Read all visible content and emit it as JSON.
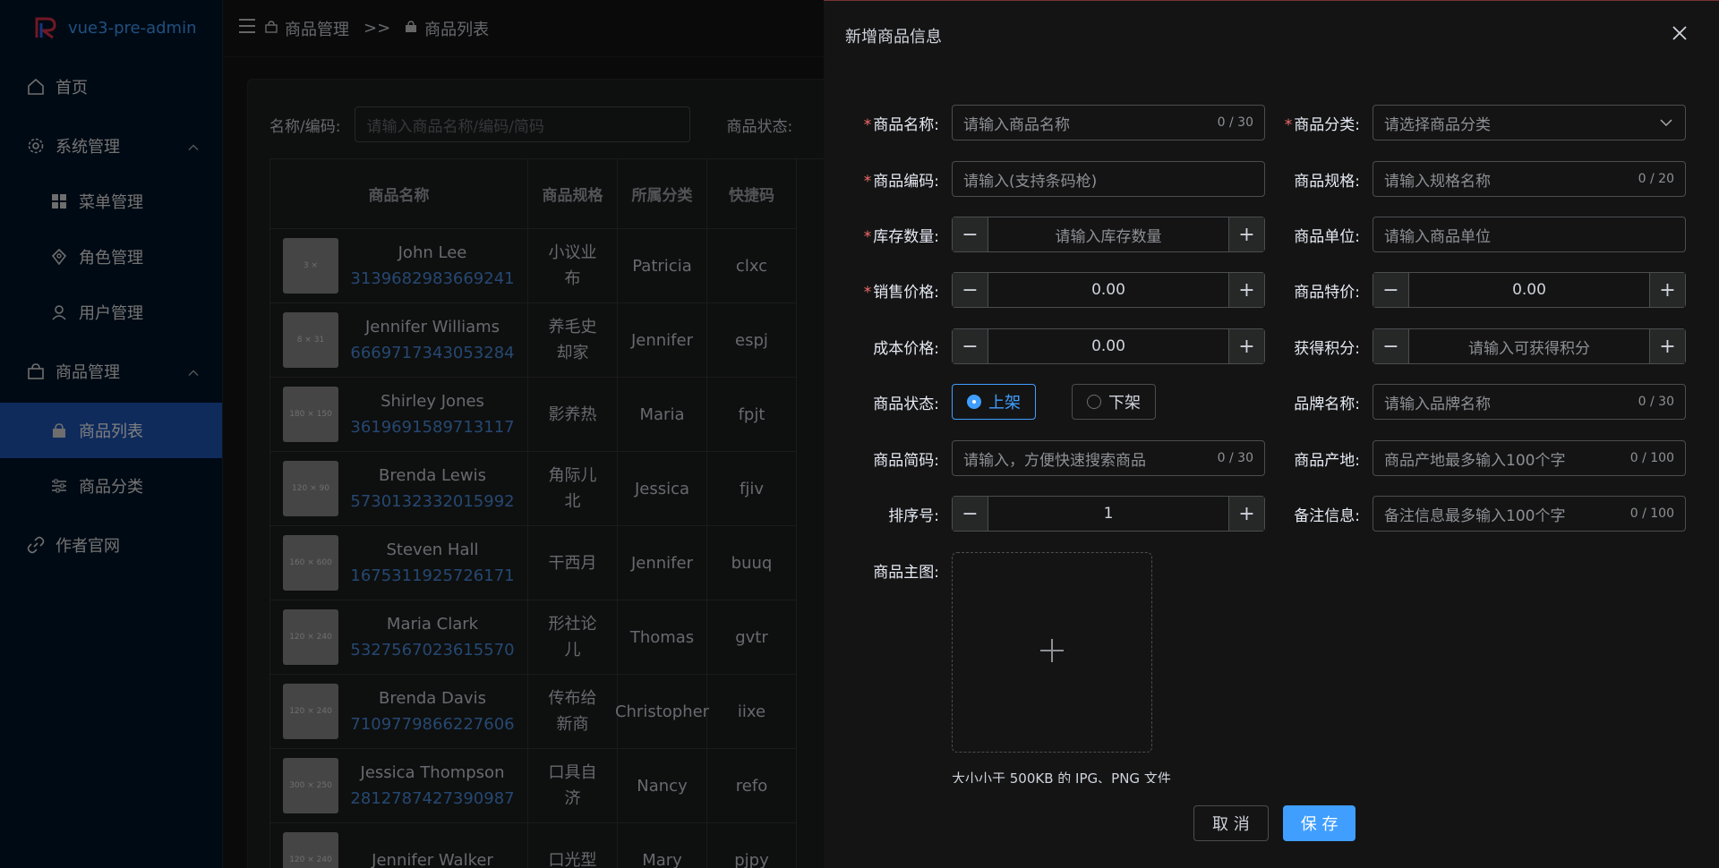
{
  "app": {
    "title": "vue3-pre-admin"
  },
  "sidebar": {
    "items": [
      {
        "label": "首页"
      },
      {
        "label": "系统管理"
      },
      {
        "label": "菜单管理"
      },
      {
        "label": "角色管理"
      },
      {
        "label": "用户管理"
      },
      {
        "label": "商品管理"
      },
      {
        "label": "商品列表"
      },
      {
        "label": "商品分类"
      },
      {
        "label": "作者官网"
      }
    ]
  },
  "breadcrumb": {
    "first": "商品管理",
    "sep": ">>",
    "second": "商品列表"
  },
  "filter": {
    "name_label": "名称/编码:",
    "name_placeholder": "请输入商品名称/编码/简码",
    "status_label": "商品状态:"
  },
  "table": {
    "headers": [
      "商品名称",
      "商品规格",
      "所属分类",
      "快捷码"
    ],
    "rows": [
      {
        "thumb": "3 ×",
        "name": "John Lee",
        "code": "3139682983669241",
        "spec": "小议业布",
        "cat": "Patricia",
        "quick": "clxc"
      },
      {
        "thumb": "8 × 31",
        "name": "Jennifer Williams",
        "code": "6669717343053284",
        "spec": "养毛史却家",
        "cat": "Jennifer",
        "quick": "espj"
      },
      {
        "thumb": "180 × 150",
        "name": "Shirley Jones",
        "code": "3619691589713117",
        "spec": "影养热",
        "cat": "Maria",
        "quick": "fpjt"
      },
      {
        "thumb": "120 × 90",
        "name": "Brenda Lewis",
        "code": "5730132332015992",
        "spec": "角际儿北",
        "cat": "Jessica",
        "quick": "fjiv"
      },
      {
        "thumb": "160 × 600",
        "name": "Steven Hall",
        "code": "1675311925726171",
        "spec": "干西月",
        "cat": "Jennifer",
        "quick": "buuq"
      },
      {
        "thumb": "120 × 240",
        "name": "Maria Clark",
        "code": "5327567023615570",
        "spec": "形社论儿",
        "cat": "Thomas",
        "quick": "gvtr"
      },
      {
        "thumb": "120 × 240",
        "name": "Brenda Davis",
        "code": "7109779866227606",
        "spec": "传布给新商",
        "cat": "Christopher",
        "quick": "iixe"
      },
      {
        "thumb": "300 × 250",
        "name": "Jessica Thompson",
        "code": "2812787427390987",
        "spec": "口具自济",
        "cat": "Nancy",
        "quick": "refo"
      },
      {
        "thumb": "120 × 240",
        "name": "Jennifer Walker",
        "code": "",
        "spec": "口光型",
        "cat": "Mary",
        "quick": "pjpy"
      }
    ]
  },
  "drawer": {
    "title": "新增商品信息",
    "fields": {
      "name": {
        "label": "商品名称:",
        "placeholder": "请输入商品名称",
        "count": "0 / 30"
      },
      "category": {
        "label": "商品分类:",
        "placeholder": "请选择商品分类"
      },
      "code": {
        "label": "商品编码:",
        "placeholder": "请输入(支持条码枪)"
      },
      "spec": {
        "label": "商品规格:",
        "placeholder": "请输入规格名称",
        "count": "0 / 20"
      },
      "stock": {
        "label": "库存数量:",
        "placeholder": "请输入库存数量"
      },
      "unit": {
        "label": "商品单位:",
        "placeholder": "请输入商品单位"
      },
      "price": {
        "label": "销售价格:",
        "value": "0.00"
      },
      "special": {
        "label": "商品特价:",
        "value": "0.00"
      },
      "cost": {
        "label": "成本价格:",
        "value": "0.00"
      },
      "points": {
        "label": "获得积分:",
        "placeholder": "请输入可获得积分"
      },
      "status": {
        "label": "商品状态:",
        "on": "上架",
        "off": "下架"
      },
      "brand": {
        "label": "品牌名称:",
        "placeholder": "请输入品牌名称",
        "count": "0 / 30"
      },
      "short": {
        "label": "商品简码:",
        "placeholder": "请输入，方便快速搜索商品",
        "count": "0 / 30"
      },
      "origin": {
        "label": "商品产地:",
        "placeholder": "商品产地最多输入100个字",
        "count": "0 / 100"
      },
      "sort": {
        "label": "排序号:",
        "value": "1"
      },
      "remark": {
        "label": "备注信息:",
        "placeholder": "备注信息最多输入100个字",
        "count": "0 / 100"
      },
      "image": {
        "label": "商品主图:",
        "tip": "大小小于 500KB 的 JPG、PNG 文件"
      }
    },
    "cancel": "取 消",
    "save": "保 存"
  },
  "colors": {
    "accent": "#409eff",
    "sidebar_bg": "#001529",
    "active_bg": "#1e56b8",
    "required": "#f56c6c"
  }
}
